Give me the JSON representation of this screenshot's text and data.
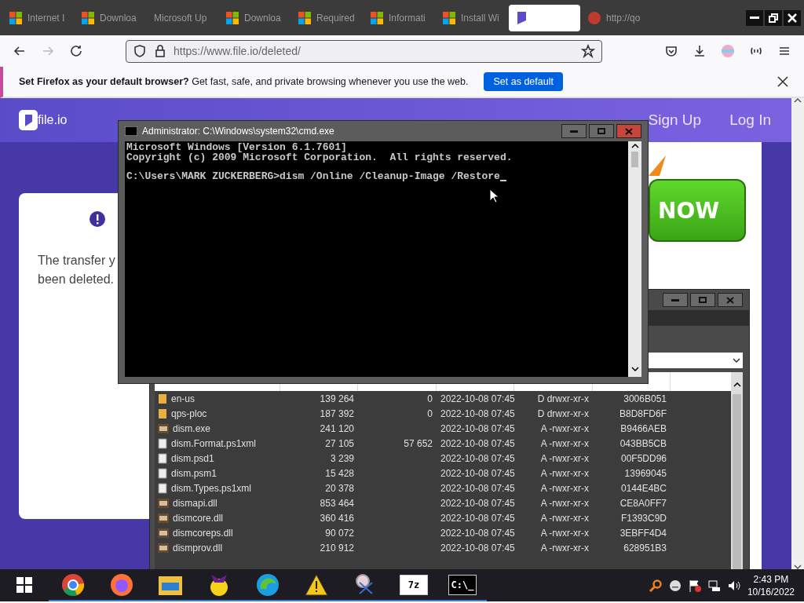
{
  "browser": {
    "tabs": [
      {
        "title": "Internet I",
        "kind": "windows",
        "selected": false
      },
      {
        "title": "Downloa",
        "kind": "windows",
        "selected": false
      },
      {
        "title": "Microsoft Up",
        "kind": "plain",
        "selected": false
      },
      {
        "title": "Downloa",
        "kind": "windows",
        "selected": false
      },
      {
        "title": "Required",
        "kind": "windows",
        "selected": false
      },
      {
        "title": "Informati",
        "kind": "windows",
        "selected": false
      },
      {
        "title": "Install Wi",
        "kind": "windows",
        "selected": false
      },
      {
        "kind": "fileio",
        "selected": true
      },
      {
        "title": "http://qo",
        "kind": "badge",
        "selected": false
      }
    ],
    "url": "https://www.file.io/deleted/"
  },
  "notification": {
    "message": "**Set Firefox as your default browser?** Get fast, safe, and private browsing whenever you use the web.",
    "button": "Set as default"
  },
  "site": {
    "logo": "file.io",
    "nav": [
      "Sign Up",
      "Log In"
    ],
    "card": {
      "lines": [
        "The transfer y",
        "been deleted."
      ]
    },
    "ad": {
      "button": "NOW"
    }
  },
  "cmd": {
    "title": "Administrator: C:\\Windows\\system32\\cmd.exe",
    "lines": [
      {
        "kind": "output",
        "text": "Microsoft Windows [Version 6.1.7601]"
      },
      {
        "kind": "output",
        "text": "Copyright (c) 2009 Microsoft Corporation.  All rights reserved."
      },
      {
        "kind": "prompt",
        "text": "C:\\Users\\MARK ZUCKERBERG>dism /Online /Cleanup-Image /Restore"
      }
    ]
  },
  "files": [
    {
      "kind": "folder",
      "name": "en-us",
      "size": "139 264",
      "packed": "0",
      "modified": "2022-10-08 07:45",
      "attributes": "D drwxr-xr-x",
      "crc": "3006B051"
    },
    {
      "kind": "folder",
      "name": "qps-ploc",
      "size": "187 392",
      "packed": "0",
      "modified": "2022-10-08 07:45",
      "attributes": "D drwxr-xr-x",
      "crc": "B8D8FD6F"
    },
    {
      "kind": "binary",
      "name": "dism.exe",
      "size": "241 120",
      "modified": "2022-10-08 07:45",
      "attributes": "A -rwxr-xr-x",
      "crc": "B9466AEB"
    },
    {
      "kind": "document",
      "name": "dism.Format.ps1xml",
      "size": "27 105",
      "packed": "57 652",
      "modified": "2022-10-08 07:45",
      "attributes": "A -rwxr-xr-x",
      "crc": "043BB5CB"
    },
    {
      "kind": "document",
      "name": "dism.psd1",
      "size": "3 239",
      "modified": "2022-10-08 07:45",
      "attributes": "A -rwxr-xr-x",
      "crc": "00F5DD96"
    },
    {
      "kind": "document",
      "name": "dism.psm1",
      "size": "15 428",
      "modified": "2022-10-08 07:45",
      "attributes": "A -rwxr-xr-x",
      "crc": "13969045"
    },
    {
      "kind": "document",
      "name": "dism.Types.ps1xml",
      "size": "20 378",
      "modified": "2022-10-08 07:45",
      "attributes": "A -rwxr-xr-x",
      "crc": "0144E4BC"
    },
    {
      "kind": "binary",
      "name": "dismapi.dll",
      "size": "853 464",
      "modified": "2022-10-08 07:45",
      "attributes": "A -rwxr-xr-x",
      "crc": "CE8A0FF7"
    },
    {
      "kind": "binary",
      "name": "dismcore.dll",
      "size": "360 416",
      "modified": "2022-10-08 07:45",
      "attributes": "A -rwxr-xr-x",
      "crc": "F1393C9D"
    },
    {
      "kind": "binary",
      "name": "dismcoreps.dll",
      "size": "90 072",
      "modified": "2022-10-08 07:45",
      "attributes": "A -rwxr-xr-x",
      "crc": "3EBFF4D4"
    },
    {
      "kind": "binary",
      "name": "dismprov.dll",
      "size": "210 912",
      "modified": "2022-10-08 07:45",
      "attributes": "A -rwxr-xr-x",
      "crc": "628951B3"
    }
  ],
  "taskbar": {
    "apps": [
      {
        "kind": "chrome"
      },
      {
        "kind": "firefox"
      },
      {
        "kind": "folder"
      },
      {
        "kind": "messenger"
      },
      {
        "kind": "edge"
      },
      {
        "kind": "warning"
      },
      {
        "kind": "scissors"
      },
      {
        "kind": "zip",
        "label": "7z"
      },
      {
        "kind": "console",
        "label": "C:\\_"
      }
    ],
    "time": "2:43 PM",
    "date": "10/16/2022"
  }
}
